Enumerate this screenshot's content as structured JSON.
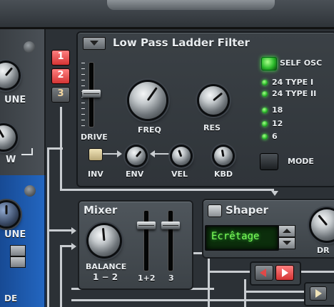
{
  "left_panel": {
    "knob1_label": "UNE",
    "knob2_label": "W"
  },
  "left_blue_panel": {
    "knob_label": "UNE",
    "bottom_label": "DE"
  },
  "osc_selector": {
    "buttons": [
      "1",
      "2",
      "3"
    ]
  },
  "filter": {
    "title": "Low Pass Ladder Filter",
    "drive_label": "DRIVE",
    "freq_label": "FREQ",
    "res_label": "RES",
    "self_osc_label": "SELF OSC",
    "modes": [
      "24 TYPE I",
      "24 TYPE II",
      "18",
      "12",
      "6"
    ],
    "mode_label": "MODE",
    "inv_label": "INV",
    "env_label": "ENV",
    "vel_label": "VEL",
    "kbd_label": "KBD"
  },
  "mixer": {
    "title": "Mixer",
    "balance_label": "BALANCE",
    "balance_sub": "1 − 2",
    "fader1_label": "1+2",
    "fader2_label": "3"
  },
  "shaper": {
    "title": "Shaper",
    "display_value": "Ecrêtage",
    "partial_label": "DR"
  },
  "colors": {
    "accent_red": "#e04848",
    "led_green": "#3ee83e",
    "lcd_text": "#7dff5a",
    "lcd_bg": "#0c2e0c",
    "blue_panel": "#1d56a8"
  }
}
